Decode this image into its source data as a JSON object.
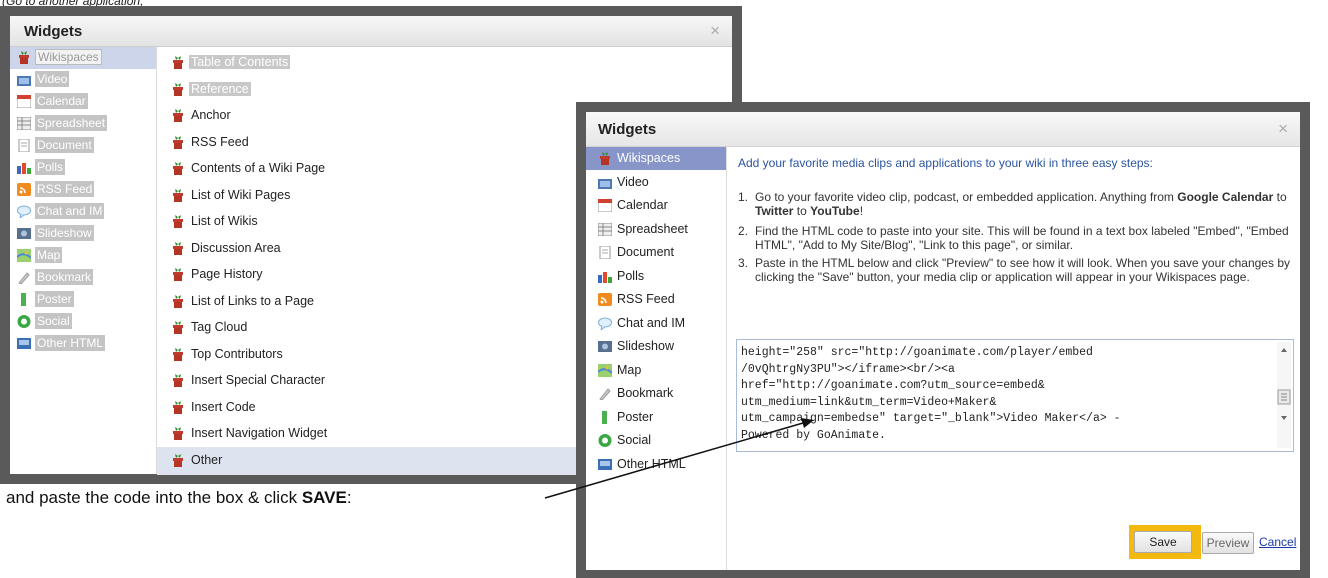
{
  "top_note": "(Go to another application, ",
  "dialog1": {
    "title": "Widgets",
    "close_glyph": "×",
    "sidebar": [
      {
        "label": "Wikispaces",
        "icon": "plant-icon",
        "selected": true
      },
      {
        "label": "Video",
        "icon": "video-icon"
      },
      {
        "label": "Calendar",
        "icon": "calendar-icon"
      },
      {
        "label": "Spreadsheet",
        "icon": "spreadsheet-icon"
      },
      {
        "label": "Document",
        "icon": "document-icon"
      },
      {
        "label": "Polls",
        "icon": "polls-icon"
      },
      {
        "label": "RSS Feed",
        "icon": "rss-icon"
      },
      {
        "label": "Chat and IM",
        "icon": "chat-icon"
      },
      {
        "label": "Slideshow",
        "icon": "slideshow-icon"
      },
      {
        "label": "Map",
        "icon": "map-icon"
      },
      {
        "label": "Bookmark",
        "icon": "bookmark-icon"
      },
      {
        "label": "Poster",
        "icon": "poster-icon"
      },
      {
        "label": "Social",
        "icon": "social-icon"
      },
      {
        "label": "Other HTML",
        "icon": "html-icon"
      }
    ],
    "items": [
      {
        "label": "Table of Contents",
        "gray": true
      },
      {
        "label": "Reference",
        "gray": true
      },
      {
        "label": "Anchor"
      },
      {
        "label": "RSS Feed"
      },
      {
        "label": "Contents of a Wiki Page"
      },
      {
        "label": "List of Wiki Pages"
      },
      {
        "label": "List of Wikis"
      },
      {
        "label": "Discussion Area"
      },
      {
        "label": "Page History"
      },
      {
        "label": "List of Links to a Page"
      },
      {
        "label": "Tag Cloud"
      },
      {
        "label": "Top Contributors"
      },
      {
        "label": "Insert Special Character"
      },
      {
        "label": "Insert Code"
      },
      {
        "label": "Insert Navigation Widget"
      },
      {
        "label": "Other",
        "selected": true
      }
    ]
  },
  "dialog2": {
    "title": "Widgets",
    "close_glyph": "×",
    "sidebar": [
      {
        "label": "Wikispaces",
        "icon": "plant-icon",
        "selected": true
      },
      {
        "label": "Video",
        "icon": "video-icon"
      },
      {
        "label": "Calendar",
        "icon": "calendar-icon"
      },
      {
        "label": "Spreadsheet",
        "icon": "spreadsheet-icon"
      },
      {
        "label": "Document",
        "icon": "document-icon"
      },
      {
        "label": "Polls",
        "icon": "polls-icon"
      },
      {
        "label": "RSS Feed",
        "icon": "rss-icon"
      },
      {
        "label": "Chat and IM",
        "icon": "chat-icon"
      },
      {
        "label": "Slideshow",
        "icon": "slideshow-icon"
      },
      {
        "label": "Map",
        "icon": "map-icon"
      },
      {
        "label": "Bookmark",
        "icon": "bookmark-icon"
      },
      {
        "label": "Poster",
        "icon": "poster-icon"
      },
      {
        "label": "Social",
        "icon": "social-icon"
      },
      {
        "label": "Other HTML",
        "icon": "html-icon"
      }
    ],
    "intro": "Add your favorite media clips and applications to your wiki in three easy steps:",
    "steps": [
      {
        "num": "1.",
        "text_html": "Go to your favorite video clip, podcast, or embedded application. Anything from <b>Google Calendar</b> to <b>Twitter</b> to <b>YouTube</b>!"
      },
      {
        "num": "2.",
        "text_html": "Find the HTML code to paste into your site. This will be found in a text box labeled \"Embed\", \"Embed HTML\", \"Add to My Site/Blog\", \"Link to this page\", or similar."
      },
      {
        "num": "3.",
        "text_html": "Paste in the HTML below and click \"Preview\" to see how it will look. When you save your changes by clicking the \"Save\" button, your media clip or application will appear in your Wikispaces page."
      }
    ],
    "code_lines": [
      "height=\"258\" src=\"http://goanimate.com/player/embed",
      "/0vQhtrgNy3PU\"></iframe><br/><a",
      "href=\"http://goanimate.com?utm_source=embed&",
      "utm_medium=link&utm_term=Video+Maker&",
      "utm_campaign=embedse\" target=\"_blank\">Video Maker</a> -",
      "Powered by GoAnimate."
    ],
    "save_label": "Save",
    "preview_label": "Preview",
    "cancel_label": "Cancel",
    "highlight_color": "#f4b90e"
  },
  "caption": {
    "before": "and paste the code into the box & click ",
    "bold": "SAVE",
    "after": ":"
  }
}
